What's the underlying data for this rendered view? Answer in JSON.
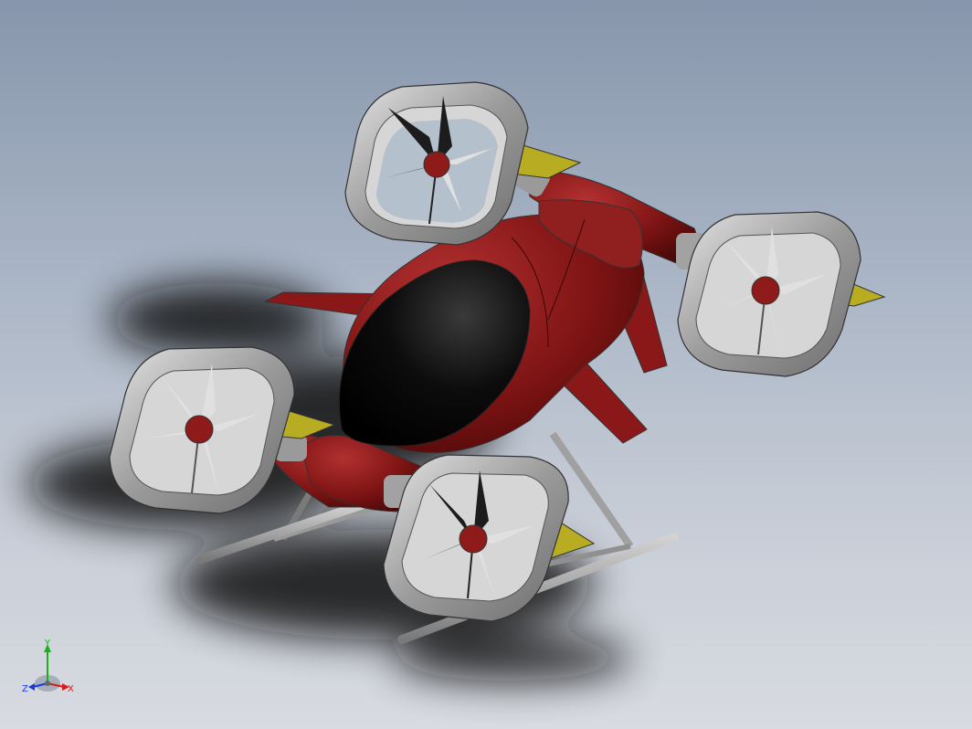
{
  "viewport": {
    "background_top": "#8796ac",
    "background_bottom": "#d8dbe1"
  },
  "model": {
    "body_color": "#7f1414",
    "canopy_color": "#0a0a0a",
    "duct_color": "#8a8a8a",
    "duct_inner_color": "#d6d6d6",
    "blade_light_color": "#e0e0e0",
    "blade_dark_color": "#1c1c1c",
    "hub_color": "#8e1a1a",
    "vane_yellow_color": "#b8ad22",
    "vane_blue_color": "#18339c",
    "skid_color": "#a8a8a8"
  },
  "triad": {
    "x_label": "X",
    "y_label": "Y",
    "z_label": "Z",
    "x_color": "#d81a1a",
    "y_color": "#1ab01a",
    "z_color": "#1a3ad8"
  }
}
